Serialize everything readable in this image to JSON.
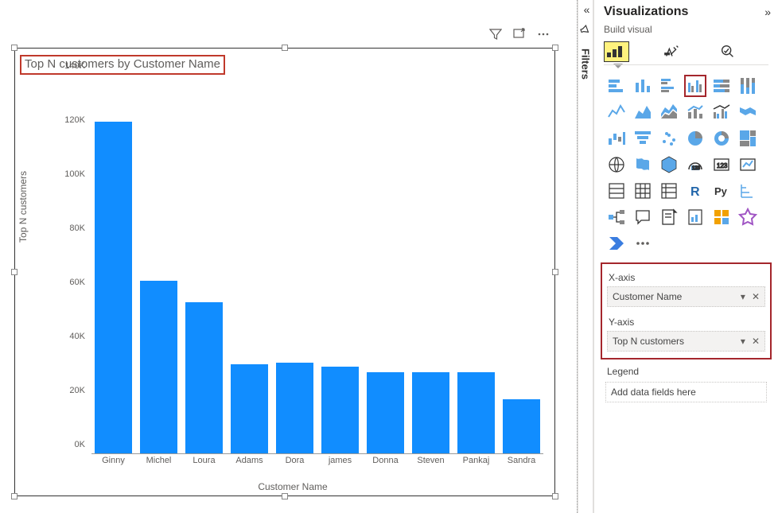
{
  "chart": {
    "title": "Top N customers by Customer Name",
    "xlabel": "Customer Name",
    "ylabel": "Top N customers"
  },
  "chart_data": {
    "type": "bar",
    "categories": [
      "Ginny",
      "Michel",
      "Loura",
      "Adams",
      "Dora",
      "james",
      "Donna",
      "Steven",
      "Pankaj",
      "Sandra"
    ],
    "values": [
      123000,
      64000,
      56000,
      33000,
      33500,
      32000,
      30000,
      30000,
      30000,
      20000
    ],
    "title": "Top N customers by Customer Name",
    "xlabel": "Customer Name",
    "ylabel": "Top N customers",
    "ylim": [
      0,
      140000
    ],
    "y_ticks": [
      0,
      20000,
      40000,
      60000,
      80000,
      100000,
      120000,
      140000
    ],
    "y_tick_labels": [
      "0K",
      "20K",
      "40K",
      "60K",
      "80K",
      "100K",
      "120K",
      "140K"
    ]
  },
  "rail": {
    "filters": "Filters"
  },
  "viz": {
    "title": "Visualizations",
    "subtitle": "Build visual",
    "wells": {
      "x_label": "X-axis",
      "x_field": "Customer Name",
      "y_label": "Y-axis",
      "y_field": "Top N customers",
      "legend_label": "Legend",
      "legend_placeholder": "Add data fields here"
    }
  }
}
